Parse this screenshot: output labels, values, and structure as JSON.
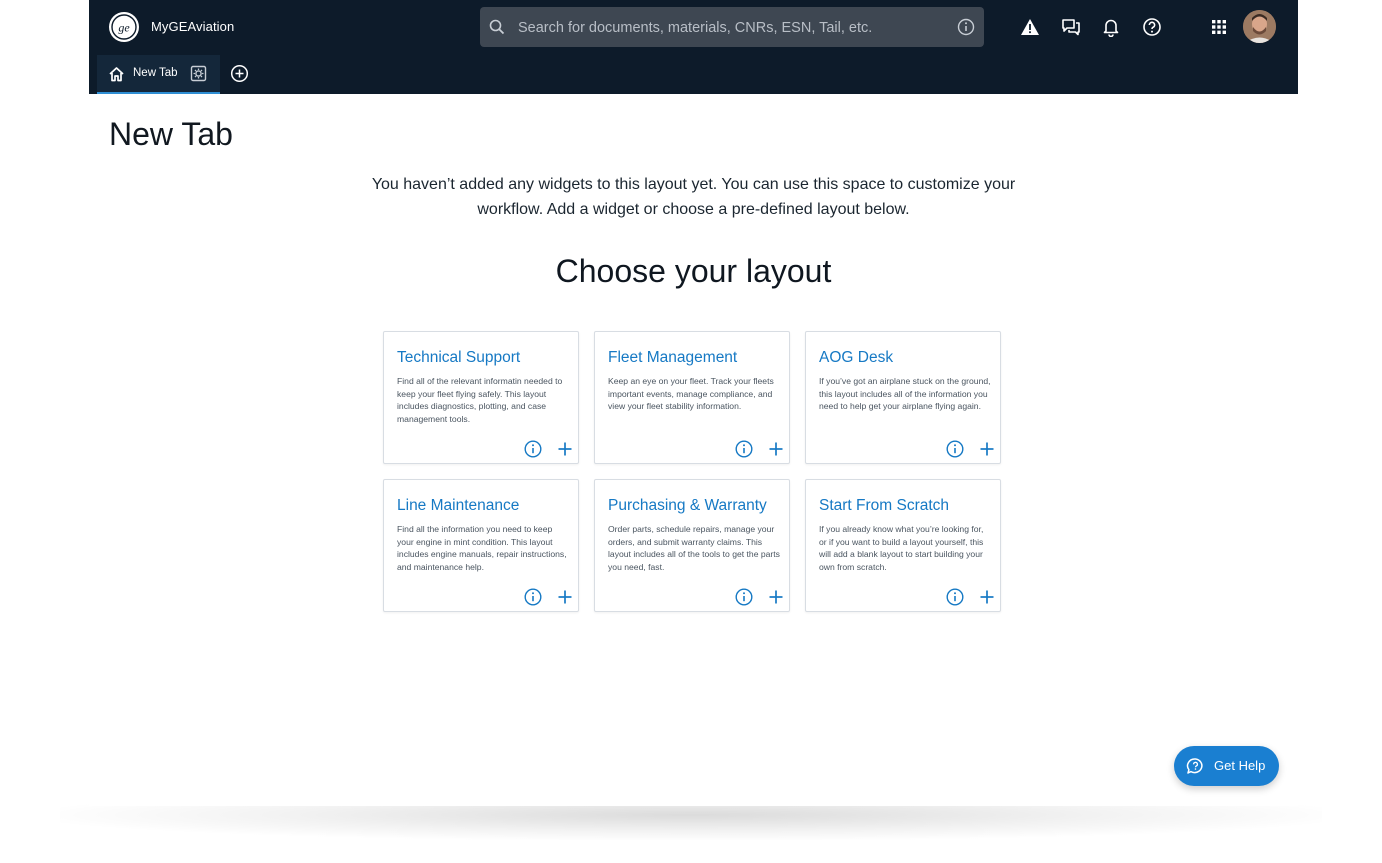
{
  "app": {
    "name": "MyGEAviation"
  },
  "search": {
    "placeholder": "Search for documents, materials, CNRs, ESN, Tail, etc."
  },
  "header_icons": [
    "warning-icon",
    "chat-icon",
    "bell-icon",
    "help-circle-icon",
    "apps-grid-icon"
  ],
  "tabs": [
    {
      "label": "New Tab",
      "active": true
    }
  ],
  "page": {
    "title": "New Tab",
    "intro": "You haven’t added any widgets to this layout yet. You can use this space to customize your workflow. Add a widget or choose a pre-defined layout below.",
    "choose_heading": "Choose your layout"
  },
  "layouts": [
    {
      "title": "Technical Support",
      "description": "Find all of the relevant informatin needed to keep your fleet flying safely. This layout includes diagnostics, plotting, and case management tools."
    },
    {
      "title": "Fleet Management",
      "description": "Keep an eye on your fleet. Track your fleets important events, manage compliance, and view your fleet stability information."
    },
    {
      "title": "AOG Desk",
      "description": "If you’ve got an airplane stuck on the ground, this layout includes all of the information you need to help get your airplane flying again."
    },
    {
      "title": "Line Maintenance",
      "description": "Find all the information you need to keep your engine in mint condition. This layout includes engine manuals, repair instructions, and maintenance help."
    },
    {
      "title": "Purchasing & Warranty",
      "description": "Order parts, schedule repairs, manage your orders, and submit warranty claims. This layout includes all of the tools to get the parts you need, fast."
    },
    {
      "title": "Start From Scratch",
      "description": "If you already know what you’re looking for, or if you want to build a layout yourself, this will add a blank layout to start building your own from scratch."
    }
  ],
  "help_button": {
    "label": "Get Help"
  },
  "colors": {
    "header_bg": "#0d1b2a",
    "accent": "#1679c4",
    "help_bg": "#1a7fd1"
  }
}
